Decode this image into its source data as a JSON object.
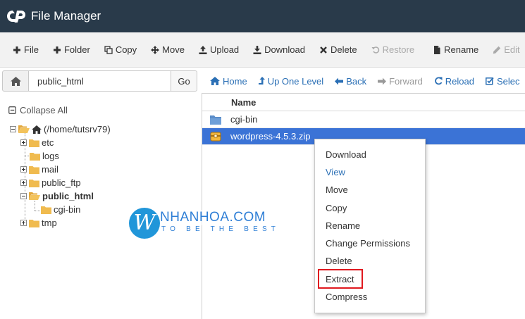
{
  "header": {
    "title": "File Manager"
  },
  "toolbar": {
    "file": "File",
    "folder": "Folder",
    "copy": "Copy",
    "move": "Move",
    "upload": "Upload",
    "download": "Download",
    "delete": "Delete",
    "restore": "Restore",
    "rename": "Rename",
    "edit": "Edit"
  },
  "nav": {
    "path_value": "public_html",
    "go_label": "Go",
    "home": "Home",
    "up": "Up One Level",
    "back": "Back",
    "forward": "Forward",
    "reload": "Reload",
    "select": "Selec"
  },
  "tree": {
    "collapse_all": "Collapse All",
    "root": "(/home/tutsrv79)",
    "items": [
      "etc",
      "logs",
      "mail",
      "public_ftp",
      "public_html",
      "cgi-bin",
      "tmp"
    ]
  },
  "files": {
    "column_name": "Name",
    "rows": [
      "cgi-bin",
      "wordpress-4.5.3.zip"
    ]
  },
  "context_menu": {
    "items": [
      "Download",
      "View",
      "Move",
      "Copy",
      "Rename",
      "Change Permissions",
      "Delete",
      "Extract",
      "Compress"
    ]
  },
  "watermark": {
    "brand": "NHANHOA.COM",
    "slogan": "TO BE THE BEST"
  },
  "colors": {
    "header_bg": "#293a4a",
    "selected_row": "#3b73d6",
    "link": "#2a6fb5",
    "highlight_box": "#e0191f",
    "watermark": "#2196d9"
  }
}
